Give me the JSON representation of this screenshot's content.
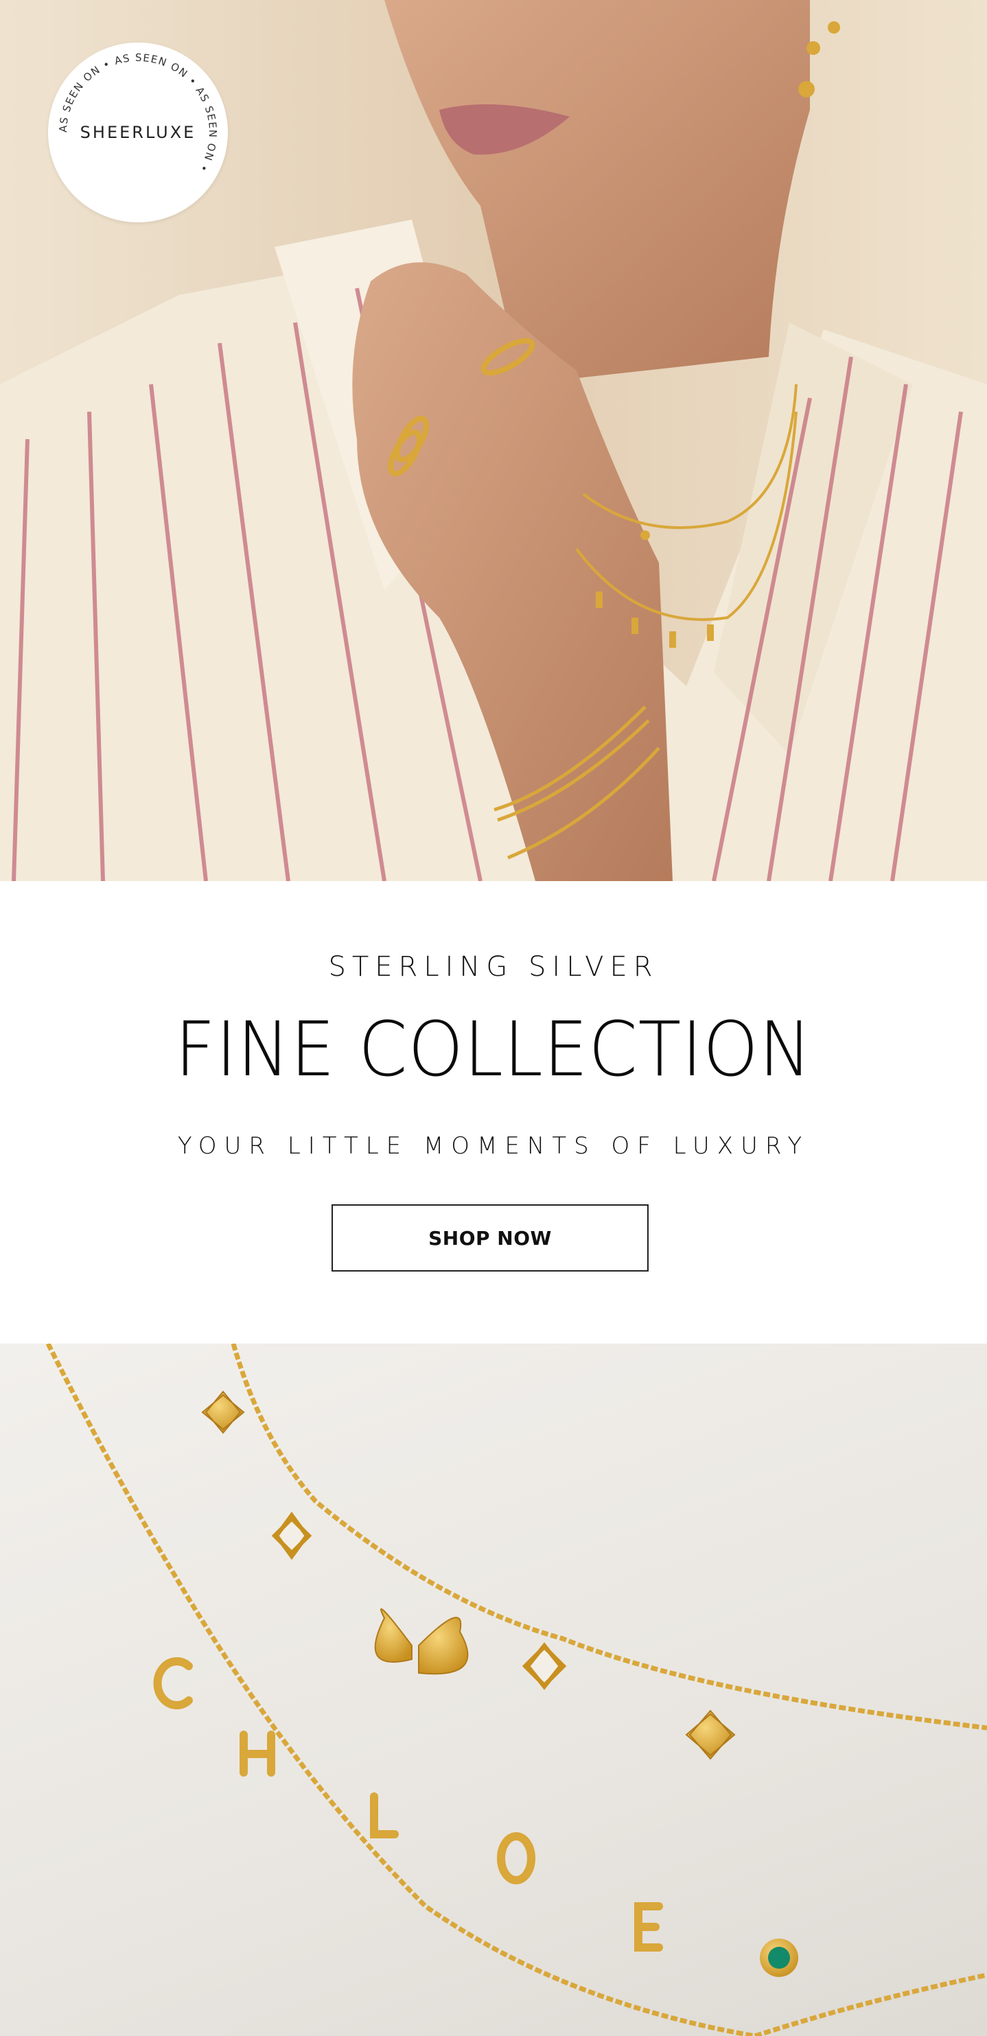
{
  "hero": {
    "badge": {
      "brand": "SHEERLUXE",
      "ring_text": "AS SEEN ON • AS SEEN ON • AS SEEN ON • "
    }
  },
  "promo": {
    "eyebrow": "STERLING SILVER",
    "headline": "FINE COLLECTION",
    "tagline": "YOUR LITTLE MOMENTS OF LUXURY",
    "cta_label": "SHOP NOW"
  },
  "colors": {
    "gold": "#d9a73a",
    "shirt": "#f3ead9",
    "stripe": "#c97a86",
    "skin": "#c99677",
    "button_border": "#222222"
  }
}
